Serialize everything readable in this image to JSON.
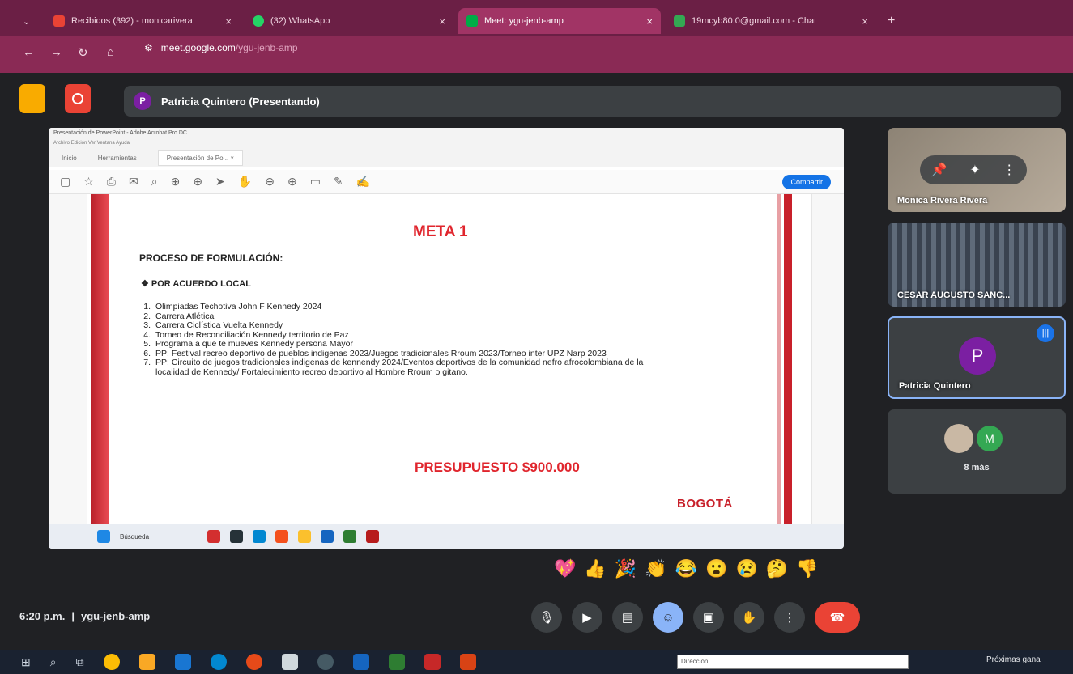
{
  "browser": {
    "tabs": [
      {
        "label": "Recibidos (392) - monicarivera",
        "favicon": "gmail-icon",
        "color": "#ea4335"
      },
      {
        "label": "(32) WhatsApp",
        "favicon": "whatsapp-icon",
        "color": "#25d366"
      },
      {
        "label": "Meet: ygu-jenb-amp",
        "favicon": "meet-icon",
        "color": "#00ac47"
      },
      {
        "label": "19mcyb80.0@gmail.com - Chat",
        "favicon": "chat-icon",
        "color": "#34a853"
      }
    ],
    "url_host": "meet.google.com",
    "url_path": "/ygu-jenb-amp"
  },
  "meet": {
    "presenter_initial": "P",
    "presenter_label": "Patricia Quintero (Presentando)",
    "time": "6:20 p.m.",
    "separator": "|",
    "meeting_code": "ygu-jenb-amp"
  },
  "acrobat": {
    "window_title": "Presentación de PowerPoint - Adobe Acrobat Pro DC",
    "menu": "Archivo  Edición  Ver  Ventana  Ayuda",
    "tab_home": "Inicio",
    "tab_tools": "Herramientas",
    "tab_doc": "Presentación de Po... ×",
    "share_label": "Compartir"
  },
  "slide": {
    "title": "META 1",
    "heading": "PROCESO DE FORMULACIÓN:",
    "subheading": "❖ POR ACUERDO LOCAL",
    "items": [
      {
        "n": "1.",
        "text": "Olimpiadas Techotiva John F Kennedy 2024"
      },
      {
        "n": "2.",
        "text": "Carrera Atlética"
      },
      {
        "n": "3.",
        "text": "Carrera Ciclística Vuelta Kennedy"
      },
      {
        "n": "4.",
        "text": "Torneo de Reconciliación Kennedy territorio de Paz"
      },
      {
        "n": "5.",
        "text": "Programa a que te mueves Kennedy persona Mayor"
      },
      {
        "n": "6.",
        "text": "PP: Festival recreo deportivo de pueblos indigenas 2023/Juegos tradicionales Rroum 2023/Torneo inter UPZ Narp 2023"
      },
      {
        "n": "7.",
        "text": "PP: Circuito de juegos tradicionales indigenas de kennendy 2024/Eventos deportivos de la comunidad nefro afrocolombiana de la localidad de Kennedy/ Fortalecimiento recreo deportivo al Hombre Rroum o gitano."
      }
    ],
    "budget": "PRESUPUESTO  $900.000",
    "logo_text": "BOGOTÁ"
  },
  "inner_taskbar": {
    "search": "Búsqueda"
  },
  "participants": [
    {
      "name": "Monica Rivera Rivera"
    },
    {
      "name": "CESAR AUGUSTO SANC..."
    },
    {
      "name": "Patricia Quintero",
      "initial": "P"
    },
    {
      "more_initial": "M",
      "more_label": "8 más"
    }
  ],
  "reactions": [
    "💖",
    "👍",
    "🎉",
    "👏",
    "😂",
    "😮",
    "😢",
    "🤔",
    "👎"
  ],
  "windows_taskbar": {
    "address_label": "Dirección",
    "news": "Próximas gana"
  },
  "colors": {
    "end_call": "#ea4335",
    "accent": "#8ab4f8",
    "slide_red": "#e0252d"
  }
}
